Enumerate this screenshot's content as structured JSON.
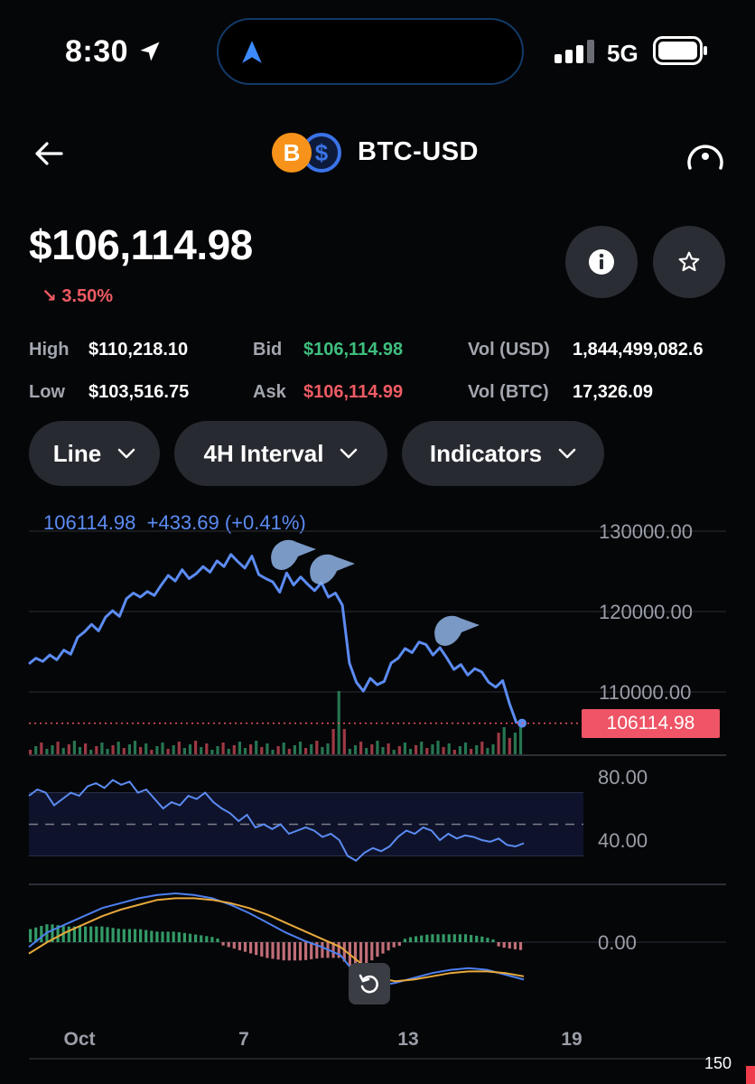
{
  "status_bar": {
    "time": "8:30",
    "network": "5G"
  },
  "header": {
    "pair": "BTC-USD"
  },
  "price": {
    "current": "$106,114.98",
    "change": "3.50%"
  },
  "stats": {
    "high_label": "High",
    "high": "$110,218.10",
    "low_label": "Low",
    "low": "$103,516.75",
    "bid_label": "Bid",
    "bid": "$106,114.98",
    "ask_label": "Ask",
    "ask": "$106,114.99",
    "vol_usd_label": "Vol (USD)",
    "vol_usd": "1,844,499,082.6",
    "vol_btc_label": "Vol (BTC)",
    "vol_btc": "17,326.09"
  },
  "controls": {
    "chart_type": "Line",
    "interval": "4H Interval",
    "indicators": "Indicators"
  },
  "chart_header": {
    "last": "106114.98",
    "change": "+433.69 (+0.41%)"
  },
  "colors": {
    "accent": "#5c8cf3",
    "up": "#3fbf7f",
    "down": "#ef5b63",
    "background": "#050608"
  },
  "icons": [
    "back-arrow-icon",
    "bitcoin-icon",
    "usd-coin-icon",
    "gauge-icon",
    "info-icon",
    "star-icon",
    "chevron-down-icon",
    "reset-icon",
    "location-arrow-icon"
  ],
  "corner_label": "150",
  "chart_data": [
    {
      "type": "line",
      "title": "",
      "x_ticks": [
        "Oct",
        "7",
        "13",
        "19"
      ],
      "y_ticks": [
        "130000.00",
        "120000.00",
        "110000.00"
      ],
      "ylim": [
        103000,
        132000
      ],
      "last_price_label": "106114.98",
      "series": [
        {
          "values": [
            113500,
            114200,
            113800,
            114600,
            114000,
            115200,
            114700,
            116800,
            117500,
            118400,
            117600,
            119300,
            120100,
            119400,
            121600,
            122300,
            121800,
            122500,
            122000,
            123300,
            124500,
            123800,
            125200,
            124100,
            124700,
            125600,
            124900,
            126300,
            125600,
            127100,
            126200,
            125400,
            126900,
            124600,
            124100,
            123700,
            122400,
            124800,
            123300,
            124300,
            123400,
            122600,
            123600,
            121800,
            122300,
            120800,
            113600,
            111200,
            110100,
            111700,
            110900,
            111300,
            113600,
            114200,
            115400,
            114900,
            116200,
            115900,
            114600,
            115500,
            114200,
            112800,
            113400,
            112100,
            112900,
            112500,
            111200,
            110600,
            111400,
            108500,
            106114.98
          ]
        }
      ]
    },
    {
      "type": "line",
      "title": "",
      "y_ticks": [
        "80.00",
        "40.00"
      ],
      "ylim": [
        20,
        90
      ],
      "series": [
        {
          "values": [
            68,
            72,
            70,
            62,
            66,
            70,
            68,
            74,
            76,
            73,
            78,
            75,
            77,
            70,
            72,
            66,
            60,
            64,
            62,
            68,
            66,
            70,
            64,
            60,
            57,
            52,
            56,
            48,
            50,
            47,
            50,
            44,
            46,
            48,
            46,
            42,
            44,
            40,
            30,
            27,
            32,
            35,
            33,
            36,
            42,
            46,
            44,
            48,
            46,
            40,
            44,
            41,
            43,
            42,
            40,
            39,
            41,
            37,
            36,
            38
          ]
        }
      ]
    },
    {
      "type": "line",
      "title": "",
      "y_ticks": [
        "0.00"
      ],
      "ylim": [
        -3,
        4
      ],
      "series": [
        {
          "values": [
            -0.3,
            0.6,
            1.1,
            1.6,
            2.1,
            2.4,
            2.7,
            2.9,
            3.0,
            2.9,
            2.7,
            2.3,
            1.8,
            1.2,
            0.6,
            0.1,
            -0.3,
            -0.8,
            -2.2,
            -2.7,
            -2.5,
            -2.2,
            -1.9,
            -1.7,
            -1.6,
            -1.7,
            -2.0,
            -2.3
          ]
        },
        {
          "values": [
            -0.7,
            0.0,
            0.6,
            1.1,
            1.6,
            2.0,
            2.3,
            2.6,
            2.7,
            2.7,
            2.6,
            2.4,
            2.1,
            1.7,
            1.2,
            0.7,
            0.2,
            -0.3,
            -1.2,
            -2.2,
            -2.4,
            -2.3,
            -2.1,
            -1.9,
            -1.8,
            -1.8,
            -1.9,
            -2.1
          ]
        }
      ]
    }
  ]
}
